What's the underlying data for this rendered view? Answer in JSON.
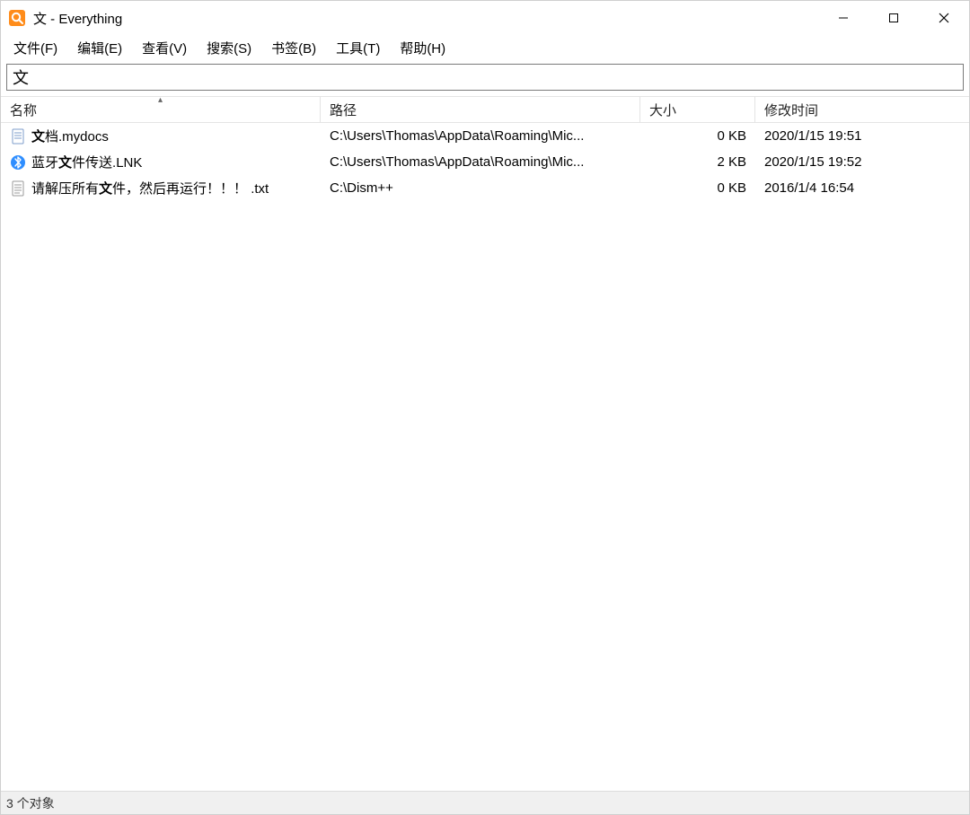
{
  "titlebar": {
    "title": "文 - Everything"
  },
  "menu": {
    "file": "文件(F)",
    "edit": "编辑(E)",
    "view": "查看(V)",
    "search": "搜索(S)",
    "bookmarks": "书签(B)",
    "tools": "工具(T)",
    "help": "帮助(H)"
  },
  "search": {
    "value": "文"
  },
  "columns": {
    "name": "名称",
    "path": "路径",
    "size": "大小",
    "date": "修改时间",
    "sort_column": "name",
    "sort_dir": "asc",
    "sort_glyph": "▴"
  },
  "rows": [
    {
      "icon": "doc-icon",
      "name_pre": "",
      "name_bold": "文",
      "name_post": "档.mydocs",
      "path": "C:\\Users\\Thomas\\AppData\\Roaming\\Mic...",
      "size": "0 KB",
      "date": "2020/1/15 19:51"
    },
    {
      "icon": "bluetooth-icon",
      "name_pre": "蓝牙",
      "name_bold": "文",
      "name_post": "件传送.LNK",
      "path": "C:\\Users\\Thomas\\AppData\\Roaming\\Mic...",
      "size": "2 KB",
      "date": "2020/1/15 19:52"
    },
    {
      "icon": "txt-icon",
      "name_pre": "请解压所有",
      "name_bold": "文",
      "name_post": "件，然后再运行！！！ .txt",
      "path": "C:\\Dism++",
      "size": "0 KB",
      "date": "2016/1/4 16:54"
    }
  ],
  "status": {
    "text": "3 个对象"
  }
}
